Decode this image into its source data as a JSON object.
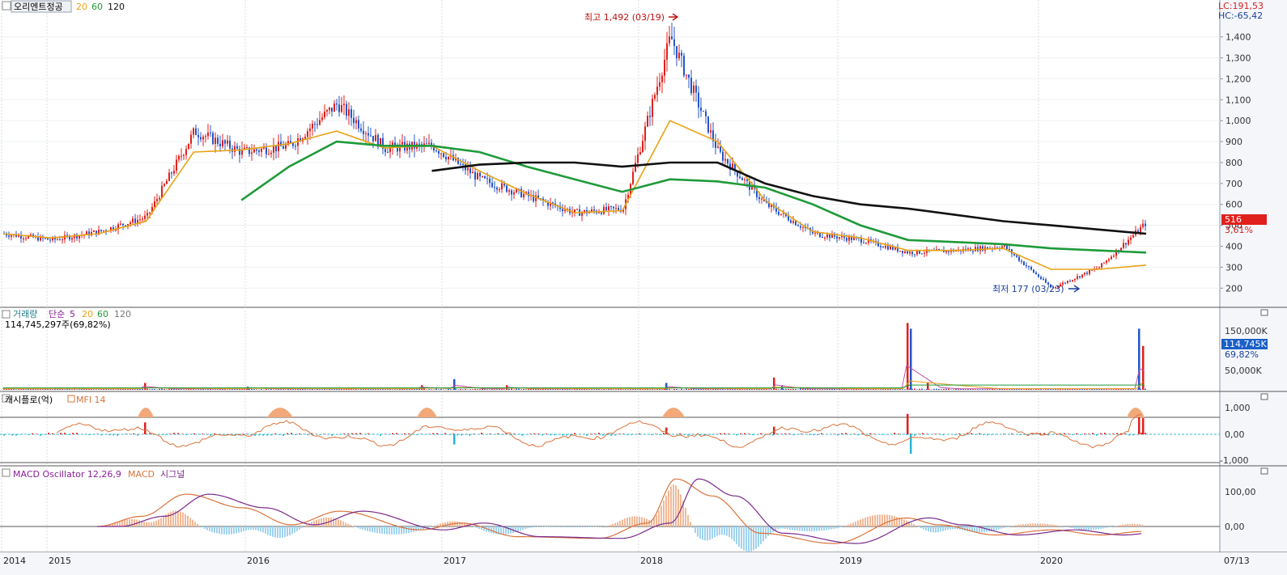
{
  "price_panel": {
    "stock_name": "오리엔트정공",
    "ma_labels": [
      "20",
      "60",
      "120"
    ],
    "lc_label": "LC:191,53",
    "hc_label": "HC:-65,42",
    "current_price": "516",
    "current_change": "3,61%",
    "high_annotation": "최고 1,492 (03/19)",
    "low_annotation": "최저 177 (03/23)",
    "colors": {
      "up": "#e0201c",
      "down": "#2456c8",
      "ma20": "#e8a317",
      "ma60": "#1f9a3a",
      "ma120": "#111111"
    }
  },
  "volume_panel": {
    "title": "거래량",
    "ma_type": "단순",
    "ma_labels": [
      "5",
      "20",
      "60",
      "120"
    ],
    "subtitle": "114,745,297주(69,82%)",
    "current_value": "114,745K",
    "current_pct": "69,82%"
  },
  "cashflow_panel": {
    "title": "캐시플로(억)",
    "indicator_label": "MFI 14"
  },
  "macd_panel": {
    "title": "MACD Oscillator 12,26,9",
    "macd_label": "MACD",
    "signal_label": "시그널"
  },
  "x_axis": {
    "labels": [
      "2014",
      "2015",
      "2016",
      "2017",
      "2018",
      "2019",
      "2020"
    ],
    "right_label": "07/13"
  },
  "chart_data": [
    {
      "type": "line",
      "title": "오리엔트정공",
      "y_ticks": [
        "1,400",
        "1,300",
        "1,200",
        "1,100",
        "1,000",
        "900",
        "800",
        "700",
        "600",
        "500",
        "400",
        "300",
        "200"
      ],
      "ylim": [
        120,
        1530
      ],
      "x": [
        "2014-11",
        "2015-01",
        "2015-04",
        "2015-07",
        "2015-10",
        "2016-01",
        "2016-04",
        "2016-07",
        "2016-10",
        "2017-01",
        "2017-04",
        "2017-07",
        "2017-10",
        "2018-01",
        "2018-03",
        "2018-06",
        "2018-09",
        "2019-01",
        "2019-04",
        "2019-07",
        "2019-10",
        "2020-01",
        "2020-03",
        "2020-05",
        "2020-07"
      ],
      "series": [
        {
          "name": "close",
          "values": [
            460,
            430,
            470,
            540,
            950,
            850,
            880,
            1080,
            870,
            880,
            720,
            640,
            560,
            580,
            1400,
            850,
            600,
            460,
            430,
            370,
            380,
            400,
            200,
            300,
            515
          ]
        },
        {
          "name": "20",
          "values": [
            460,
            440,
            460,
            520,
            850,
            860,
            890,
            950,
            870,
            880,
            760,
            650,
            560,
            570,
            1000,
            900,
            620,
            470,
            440,
            380,
            380,
            390,
            290,
            290,
            310
          ]
        },
        {
          "name": "60",
          "values": [
            null,
            null,
            null,
            null,
            null,
            620,
            780,
            900,
            880,
            880,
            850,
            780,
            720,
            660,
            720,
            710,
            680,
            600,
            500,
            430,
            420,
            410,
            390,
            380,
            370
          ]
        },
        {
          "name": "120",
          "values": [
            null,
            null,
            null,
            null,
            null,
            null,
            null,
            null,
            null,
            760,
            790,
            800,
            800,
            780,
            800,
            800,
            700,
            640,
            600,
            580,
            550,
            520,
            500,
            480,
            460
          ]
        }
      ],
      "annotations": [
        {
          "text": "최고 1,492 (03/19)",
          "value": 1492
        },
        {
          "text": "최저 177 (03/23)",
          "value": 177
        }
      ]
    },
    {
      "type": "bar",
      "title": "거래량",
      "y_ticks": [
        "150,000K",
        "50,000K"
      ],
      "ylim": [
        0,
        180000
      ],
      "spikes_thousand": [
        {
          "x": "2015-08",
          "value": 18000
        },
        {
          "x": "2016-07",
          "value": 8000
        },
        {
          "x": "2016-12",
          "value": 12000
        },
        {
          "x": "2016-12b",
          "value": 28000
        },
        {
          "x": "2017-03",
          "value": 12000
        },
        {
          "x": "2018-02",
          "value": 18000
        },
        {
          "x": "2018-08",
          "value": 32000
        },
        {
          "x": "2018-09",
          "value": 12000
        },
        {
          "x": "2019-04",
          "value": 175000
        },
        {
          "x": "2019-04b",
          "value": 160000
        },
        {
          "x": "2019-05",
          "value": 18000
        },
        {
          "x": "2020-07",
          "value": 160000
        },
        {
          "x": "2020-07b",
          "value": 114745
        }
      ]
    },
    {
      "type": "line",
      "title": "캐시플로(억)",
      "y_ticks": [
        "1,000",
        "0,00",
        "-1,000"
      ],
      "ylim": [
        -1100,
        1100
      ]
    },
    {
      "type": "line",
      "title": "MACD Oscillator 12,26,9",
      "y_ticks": [
        "100,00",
        "0,00"
      ],
      "ylim": [
        -60,
        150
      ]
    }
  ]
}
